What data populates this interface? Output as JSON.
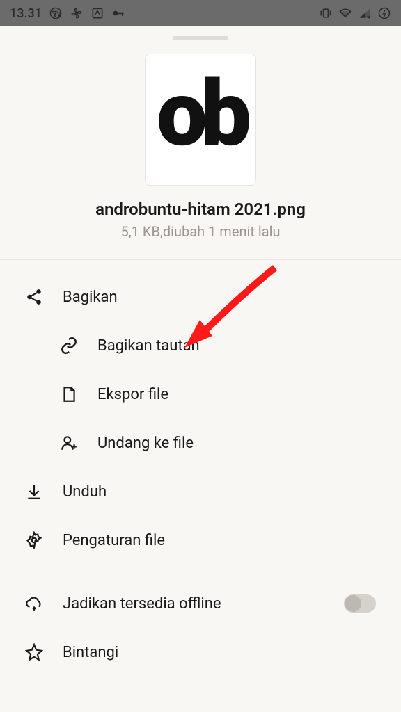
{
  "status": {
    "time": "13.31"
  },
  "file": {
    "name": "androbuntu-hitam 2021.png",
    "meta": "5,1 KB,diubah 1 menit lalu"
  },
  "menu": {
    "share": "Bagikan",
    "share_link": "Bagikan tautan",
    "export": "Ekspor file",
    "invite": "Undang ke file",
    "download": "Unduh",
    "settings": "Pengaturan file",
    "offline": "Jadikan tersedia offline",
    "star": "Bintangi"
  }
}
